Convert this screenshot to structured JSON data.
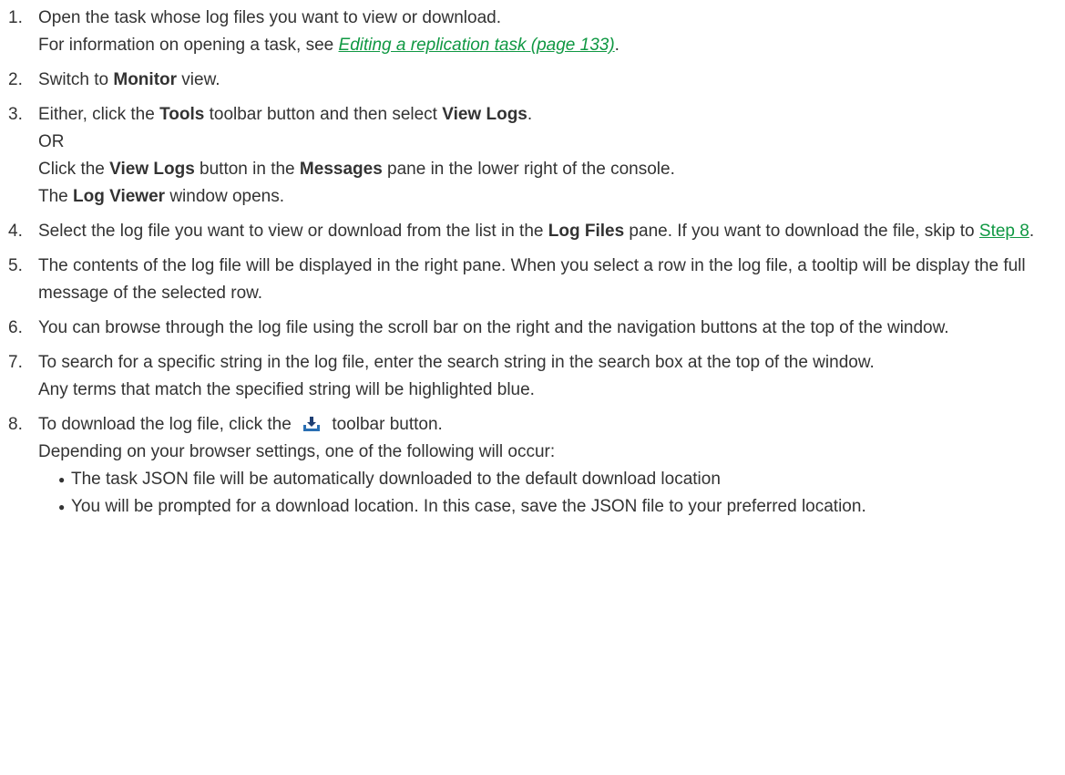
{
  "steps": [
    {
      "num": "1.",
      "a": "Open the task whose log files you want to view or download.",
      "b": "For information on opening a task, see ",
      "link": "Editing a replication task (page 133)",
      "b_end": "."
    },
    {
      "num": "2.",
      "pre": "Switch to ",
      "bold": "Monitor",
      "post": " view."
    },
    {
      "num": "3.",
      "l1_a": "Either, click the ",
      "l1_b": "Tools",
      "l1_c": " toolbar button and then select ",
      "l1_d": "View Logs",
      "l1_e": ".",
      "l2": "OR",
      "l3_a": "Click the ",
      "l3_b": "View Logs",
      "l3_c": " button in the ",
      "l3_d": "Messages",
      "l3_e": " pane in the lower right of the console.",
      "l4_a": "The ",
      "l4_b": "Log Viewer",
      "l4_c": " window opens."
    },
    {
      "num": "4.",
      "a": "Select the log file you want to view or download from the list in the ",
      "b": "Log Files",
      "c": " pane. If you want to download the file, skip to ",
      "link": "Step 8",
      "d": "."
    },
    {
      "num": "5.",
      "text": "The contents of the log file will be displayed in the right pane. When you select a row in the log file, a tooltip will be display the full message of the selected row."
    },
    {
      "num": "6.",
      "text": "You can browse through the log file using the scroll bar on the right and the navigation buttons at the top of the window."
    },
    {
      "num": "7.",
      "text": "To search for a specific string in the log file, enter the search string in the search box at the top of the window.",
      "text2": "Any terms that match the specified string will be highlighted blue."
    },
    {
      "num": "8.",
      "a": "To download the log file, click the ",
      "icon": "download-icon",
      "b": " toolbar button.",
      "c": "Depending on your browser settings, one of the following will occur:",
      "bullets": [
        "The task JSON file will be automatically downloaded to the default download location",
        "You will be prompted for a download location. In this case, save the JSON file to your preferred location."
      ]
    }
  ],
  "colors": {
    "text": "#333333",
    "link": "#109843",
    "icon_tray": "#2a6fb3",
    "icon_arrow": "#1f3f73"
  }
}
